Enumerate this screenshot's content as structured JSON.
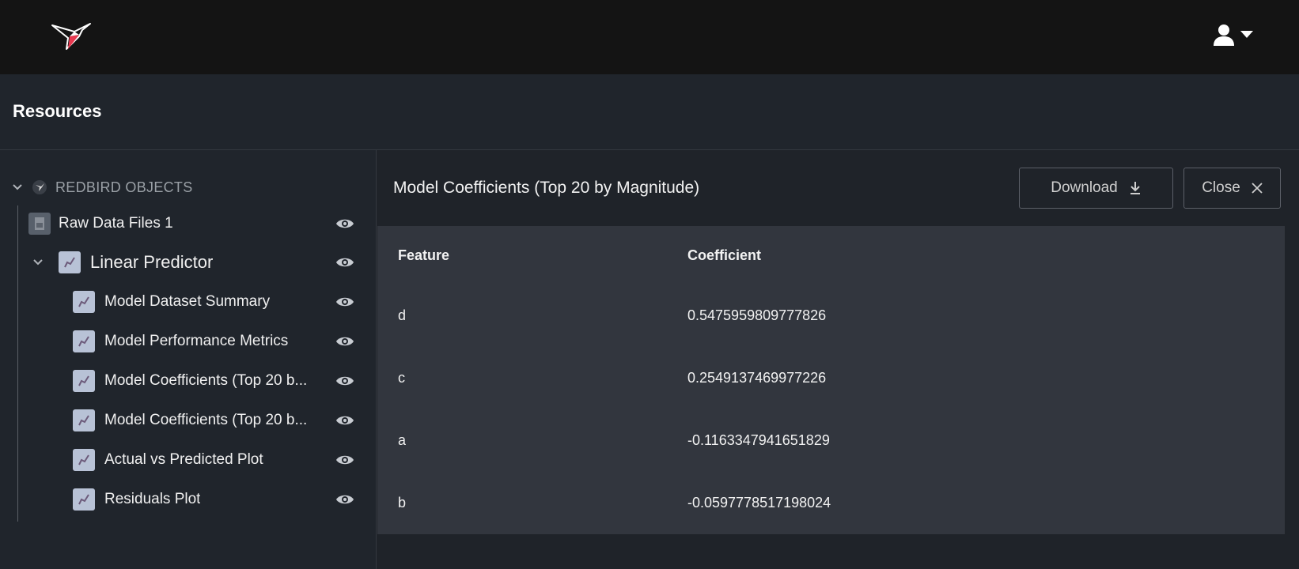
{
  "header": {
    "brand_icon": "hummingbird-logo-icon",
    "user_icon": "user-icon",
    "user_caret_icon": "caret-down-icon"
  },
  "resources": {
    "title": "Resources"
  },
  "sidebar": {
    "root": {
      "label": "REDBIRD OBJECTS",
      "icon": "redbird-icon",
      "expand_icon": "chevron-down-icon"
    },
    "items": [
      {
        "label": "Raw Data Files 1",
        "icon": "file-icon",
        "level": 1
      },
      {
        "label": "Linear Predictor",
        "icon": "chart-file-icon",
        "level": 1,
        "expanded": true
      },
      {
        "label": "Model Dataset Summary",
        "icon": "chart-file-icon",
        "level": 2
      },
      {
        "label": "Model Performance Metrics",
        "icon": "chart-file-icon",
        "level": 2
      },
      {
        "label": "Model Coefficients (Top 20 b...",
        "icon": "chart-file-icon",
        "level": 2
      },
      {
        "label": "Model Coefficients (Top 20 b...",
        "icon": "chart-file-icon",
        "level": 2
      },
      {
        "label": "Actual vs Predicted Plot",
        "icon": "chart-file-icon",
        "level": 2
      },
      {
        "label": "Residuals Plot",
        "icon": "chart-file-icon",
        "level": 2
      }
    ],
    "view_icon": "eye-icon"
  },
  "panel": {
    "title": "Model Coefficients (Top 20 by Magnitude)",
    "download_label": "Download",
    "download_icon": "download-icon",
    "close_label": "Close",
    "close_icon": "close-icon"
  },
  "table": {
    "columns": [
      "Feature",
      "Coefficient"
    ],
    "rows": [
      {
        "feature": "d",
        "coefficient": "0.5475959809777826"
      },
      {
        "feature": "c",
        "coefficient": "0.2549137469977226"
      },
      {
        "feature": "a",
        "coefficient": "-0.1163347941651829"
      },
      {
        "feature": "b",
        "coefficient": "-0.0597778517198024"
      }
    ]
  },
  "colors": {
    "topbar": "#141414",
    "background": "#1f2329",
    "table_bg": "#32363e",
    "brand_red": "#e8384f"
  }
}
